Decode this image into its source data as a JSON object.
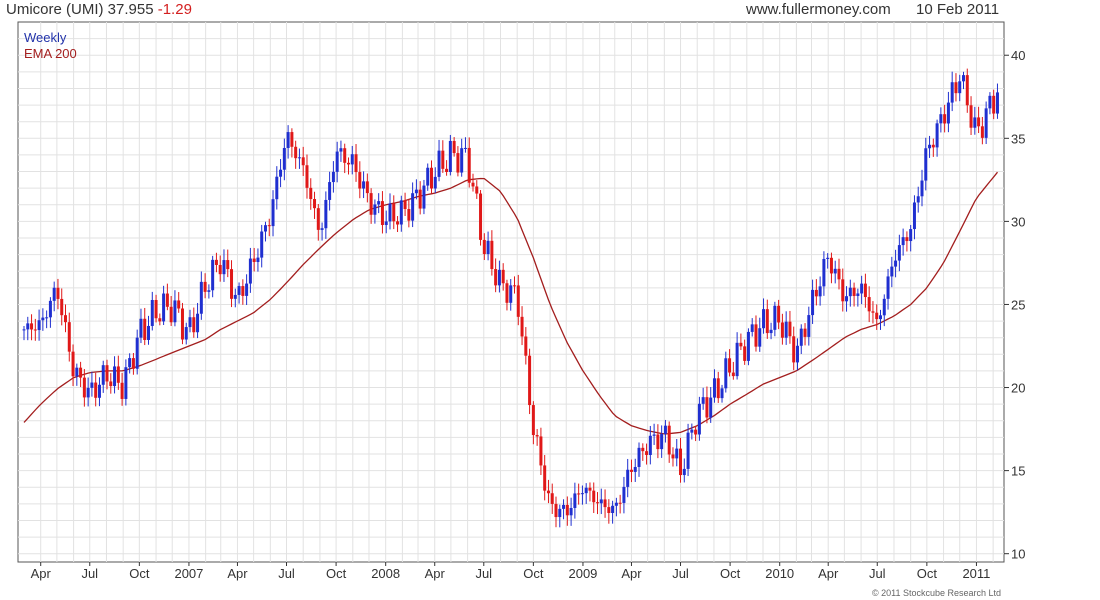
{
  "header": {
    "ticker_label": "Umicore (UMI) 37.955",
    "change": "-1.29",
    "site": "www.fullermoney.com",
    "date": "10 Feb 2011"
  },
  "legend": {
    "weekly": "Weekly",
    "ema": "EMA 200"
  },
  "footer": {
    "copyright": "© 2011 Stockcube Research Ltd"
  },
  "colors": {
    "up": "#1f2fd0",
    "down": "#e01818",
    "ema": "#a31e1e",
    "grid": "#e2e2e2",
    "axis": "#333333"
  },
  "chart_data": {
    "type": "line",
    "title": "Umicore (UMI) 37.955 -1.29",
    "ylim": [
      9.5,
      42
    ],
    "yticks": [
      10,
      15,
      20,
      25,
      30,
      35,
      40
    ],
    "xtick_labels": [
      "Apr",
      "Jul",
      "Oct",
      "2007",
      "Apr",
      "Jul",
      "Oct",
      "2008",
      "Apr",
      "Jul",
      "Oct",
      "2009",
      "Apr",
      "Jul",
      "Oct",
      "2010",
      "Apr",
      "Jul",
      "Oct",
      "2011"
    ],
    "x_start": "2006-03-01",
    "x_end": "2011-02-10",
    "grid": true,
    "series": [
      {
        "name": "Weekly",
        "kind": "candlestick",
        "points": [
          [
            "2006-03-01",
            23.5
          ],
          [
            "2006-04-01",
            23.8
          ],
          [
            "2006-05-01",
            26.0
          ],
          [
            "2006-06-01",
            21.0
          ],
          [
            "2006-07-01",
            19.6
          ],
          [
            "2006-08-01",
            20.8
          ],
          [
            "2006-09-01",
            20.1
          ],
          [
            "2006-10-01",
            23.2
          ],
          [
            "2006-11-01",
            24.6
          ],
          [
            "2006-12-01",
            24.9
          ],
          [
            "2007-01-01",
            23.2
          ],
          [
            "2007-02-01",
            26.2
          ],
          [
            "2007-03-01",
            27.7
          ],
          [
            "2007-04-01",
            25.2
          ],
          [
            "2007-05-01",
            27.6
          ],
          [
            "2007-06-01",
            30.4
          ],
          [
            "2007-07-01",
            35.2
          ],
          [
            "2007-08-01",
            33.2
          ],
          [
            "2007-09-01",
            29.2
          ],
          [
            "2007-10-01",
            34.2
          ],
          [
            "2007-11-01",
            33.5
          ],
          [
            "2007-12-01",
            31.2
          ],
          [
            "2008-01-01",
            30.2
          ],
          [
            "2008-02-01",
            30.5
          ],
          [
            "2008-03-01",
            31.5
          ],
          [
            "2008-04-01",
            33.0
          ],
          [
            "2008-05-01",
            34.0
          ],
          [
            "2008-06-01",
            33.8
          ],
          [
            "2008-07-01",
            28.5
          ],
          [
            "2008-08-01",
            26.2
          ],
          [
            "2008-09-01",
            25.5
          ],
          [
            "2008-10-01",
            17.5
          ],
          [
            "2008-11-01",
            12.8
          ],
          [
            "2008-12-01",
            12.5
          ],
          [
            "2009-01-01",
            14.0
          ],
          [
            "2009-02-01",
            13.0
          ],
          [
            "2009-03-01",
            12.6
          ],
          [
            "2009-04-01",
            15.2
          ],
          [
            "2009-05-01",
            16.6
          ],
          [
            "2009-06-01",
            17.2
          ],
          [
            "2009-07-01",
            15.0
          ],
          [
            "2009-08-01",
            18.4
          ],
          [
            "2009-09-01",
            19.6
          ],
          [
            "2009-10-01",
            21.2
          ],
          [
            "2009-11-01",
            22.8
          ],
          [
            "2009-12-01",
            23.8
          ],
          [
            "2010-01-01",
            24.1
          ],
          [
            "2010-02-01",
            22.0
          ],
          [
            "2010-03-01",
            25.0
          ],
          [
            "2010-04-01",
            27.9
          ],
          [
            "2010-05-01",
            25.4
          ],
          [
            "2010-06-01",
            26.0
          ],
          [
            "2010-07-01",
            23.8
          ],
          [
            "2010-08-01",
            27.8
          ],
          [
            "2010-09-01",
            29.6
          ],
          [
            "2010-10-01",
            34.2
          ],
          [
            "2010-11-01",
            36.4
          ],
          [
            "2010-12-01",
            38.8
          ],
          [
            "2011-01-01",
            35.2
          ],
          [
            "2011-02-10",
            37.9
          ]
        ]
      },
      {
        "name": "EMA 200",
        "kind": "line",
        "points": [
          [
            "2006-03-01",
            17.9
          ],
          [
            "2006-04-01",
            19.0
          ],
          [
            "2006-05-01",
            19.9
          ],
          [
            "2006-06-01",
            20.6
          ],
          [
            "2006-07-01",
            20.9
          ],
          [
            "2006-08-01",
            21.0
          ],
          [
            "2006-09-01",
            21.0
          ],
          [
            "2006-10-01",
            21.3
          ],
          [
            "2006-11-01",
            21.7
          ],
          [
            "2006-12-01",
            22.1
          ],
          [
            "2007-01-01",
            22.5
          ],
          [
            "2007-02-01",
            22.9
          ],
          [
            "2007-03-01",
            23.5
          ],
          [
            "2007-04-01",
            24.0
          ],
          [
            "2007-05-01",
            24.5
          ],
          [
            "2007-06-01",
            25.3
          ],
          [
            "2007-07-01",
            26.3
          ],
          [
            "2007-08-01",
            27.4
          ],
          [
            "2007-09-01",
            28.4
          ],
          [
            "2007-10-01",
            29.3
          ],
          [
            "2007-11-01",
            30.1
          ],
          [
            "2007-12-01",
            30.7
          ],
          [
            "2008-01-01",
            31.0
          ],
          [
            "2008-02-01",
            31.2
          ],
          [
            "2008-03-01",
            31.5
          ],
          [
            "2008-04-01",
            31.7
          ],
          [
            "2008-05-01",
            32.0
          ],
          [
            "2008-06-01",
            32.5
          ],
          [
            "2008-07-01",
            32.6
          ],
          [
            "2008-08-01",
            31.8
          ],
          [
            "2008-09-01",
            30.2
          ],
          [
            "2008-10-01",
            27.8
          ],
          [
            "2008-11-01",
            25.0
          ],
          [
            "2008-12-01",
            22.8
          ],
          [
            "2009-01-01",
            21.0
          ],
          [
            "2009-02-01",
            19.5
          ],
          [
            "2009-03-01",
            18.3
          ],
          [
            "2009-04-01",
            17.7
          ],
          [
            "2009-05-01",
            17.4
          ],
          [
            "2009-06-01",
            17.2
          ],
          [
            "2009-07-01",
            17.3
          ],
          [
            "2009-08-01",
            17.7
          ],
          [
            "2009-09-01",
            18.3
          ],
          [
            "2009-10-01",
            19.0
          ],
          [
            "2009-11-01",
            19.6
          ],
          [
            "2009-12-01",
            20.2
          ],
          [
            "2010-01-01",
            20.6
          ],
          [
            "2010-02-01",
            21.0
          ],
          [
            "2010-03-01",
            21.6
          ],
          [
            "2010-04-01",
            22.3
          ],
          [
            "2010-05-01",
            23.0
          ],
          [
            "2010-06-01",
            23.5
          ],
          [
            "2010-07-01",
            23.8
          ],
          [
            "2010-08-01",
            24.3
          ],
          [
            "2010-09-01",
            25.0
          ],
          [
            "2010-10-01",
            26.0
          ],
          [
            "2010-11-01",
            27.5
          ],
          [
            "2010-12-01",
            29.4
          ],
          [
            "2011-01-01",
            31.4
          ],
          [
            "2011-02-10",
            33.0
          ]
        ]
      }
    ]
  }
}
